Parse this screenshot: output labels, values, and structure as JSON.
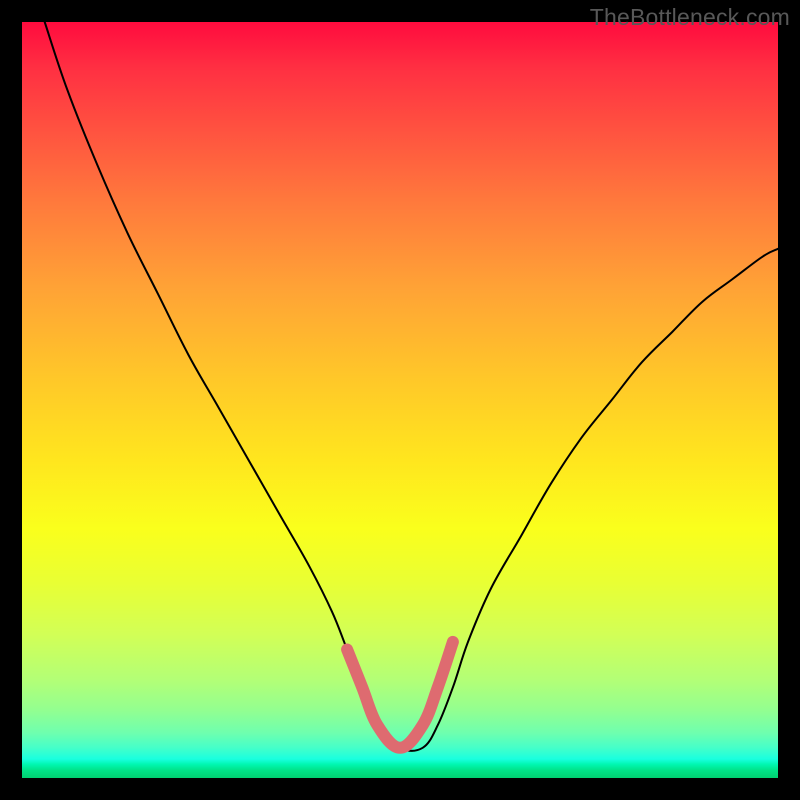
{
  "watermark": "TheBottleneck.com",
  "chart_data": {
    "type": "line",
    "title": "",
    "xlabel": "",
    "ylabel": "",
    "xlim": [
      0,
      100
    ],
    "ylim": [
      0,
      100
    ],
    "series": [
      {
        "name": "black-curve",
        "color": "#000000",
        "stroke_width": 2,
        "x": [
          3,
          6,
          10,
          14,
          18,
          22,
          26,
          30,
          34,
          38,
          41,
          43,
          45,
          47,
          50,
          53,
          55,
          57,
          59,
          62,
          66,
          70,
          74,
          78,
          82,
          86,
          90,
          94,
          98,
          100
        ],
        "values": [
          100,
          91,
          81,
          72,
          64,
          56,
          49,
          42,
          35,
          28,
          22,
          17,
          12,
          7,
          4,
          4,
          7,
          12,
          18,
          25,
          32,
          39,
          45,
          50,
          55,
          59,
          63,
          66,
          69,
          70
        ]
      },
      {
        "name": "pink-highlight",
        "color": "#de6b70",
        "stroke_width": 12,
        "x": [
          43,
          45,
          47,
          50,
          53,
          55,
          57
        ],
        "values": [
          17,
          12,
          7,
          4,
          7,
          12,
          18
        ]
      }
    ]
  }
}
